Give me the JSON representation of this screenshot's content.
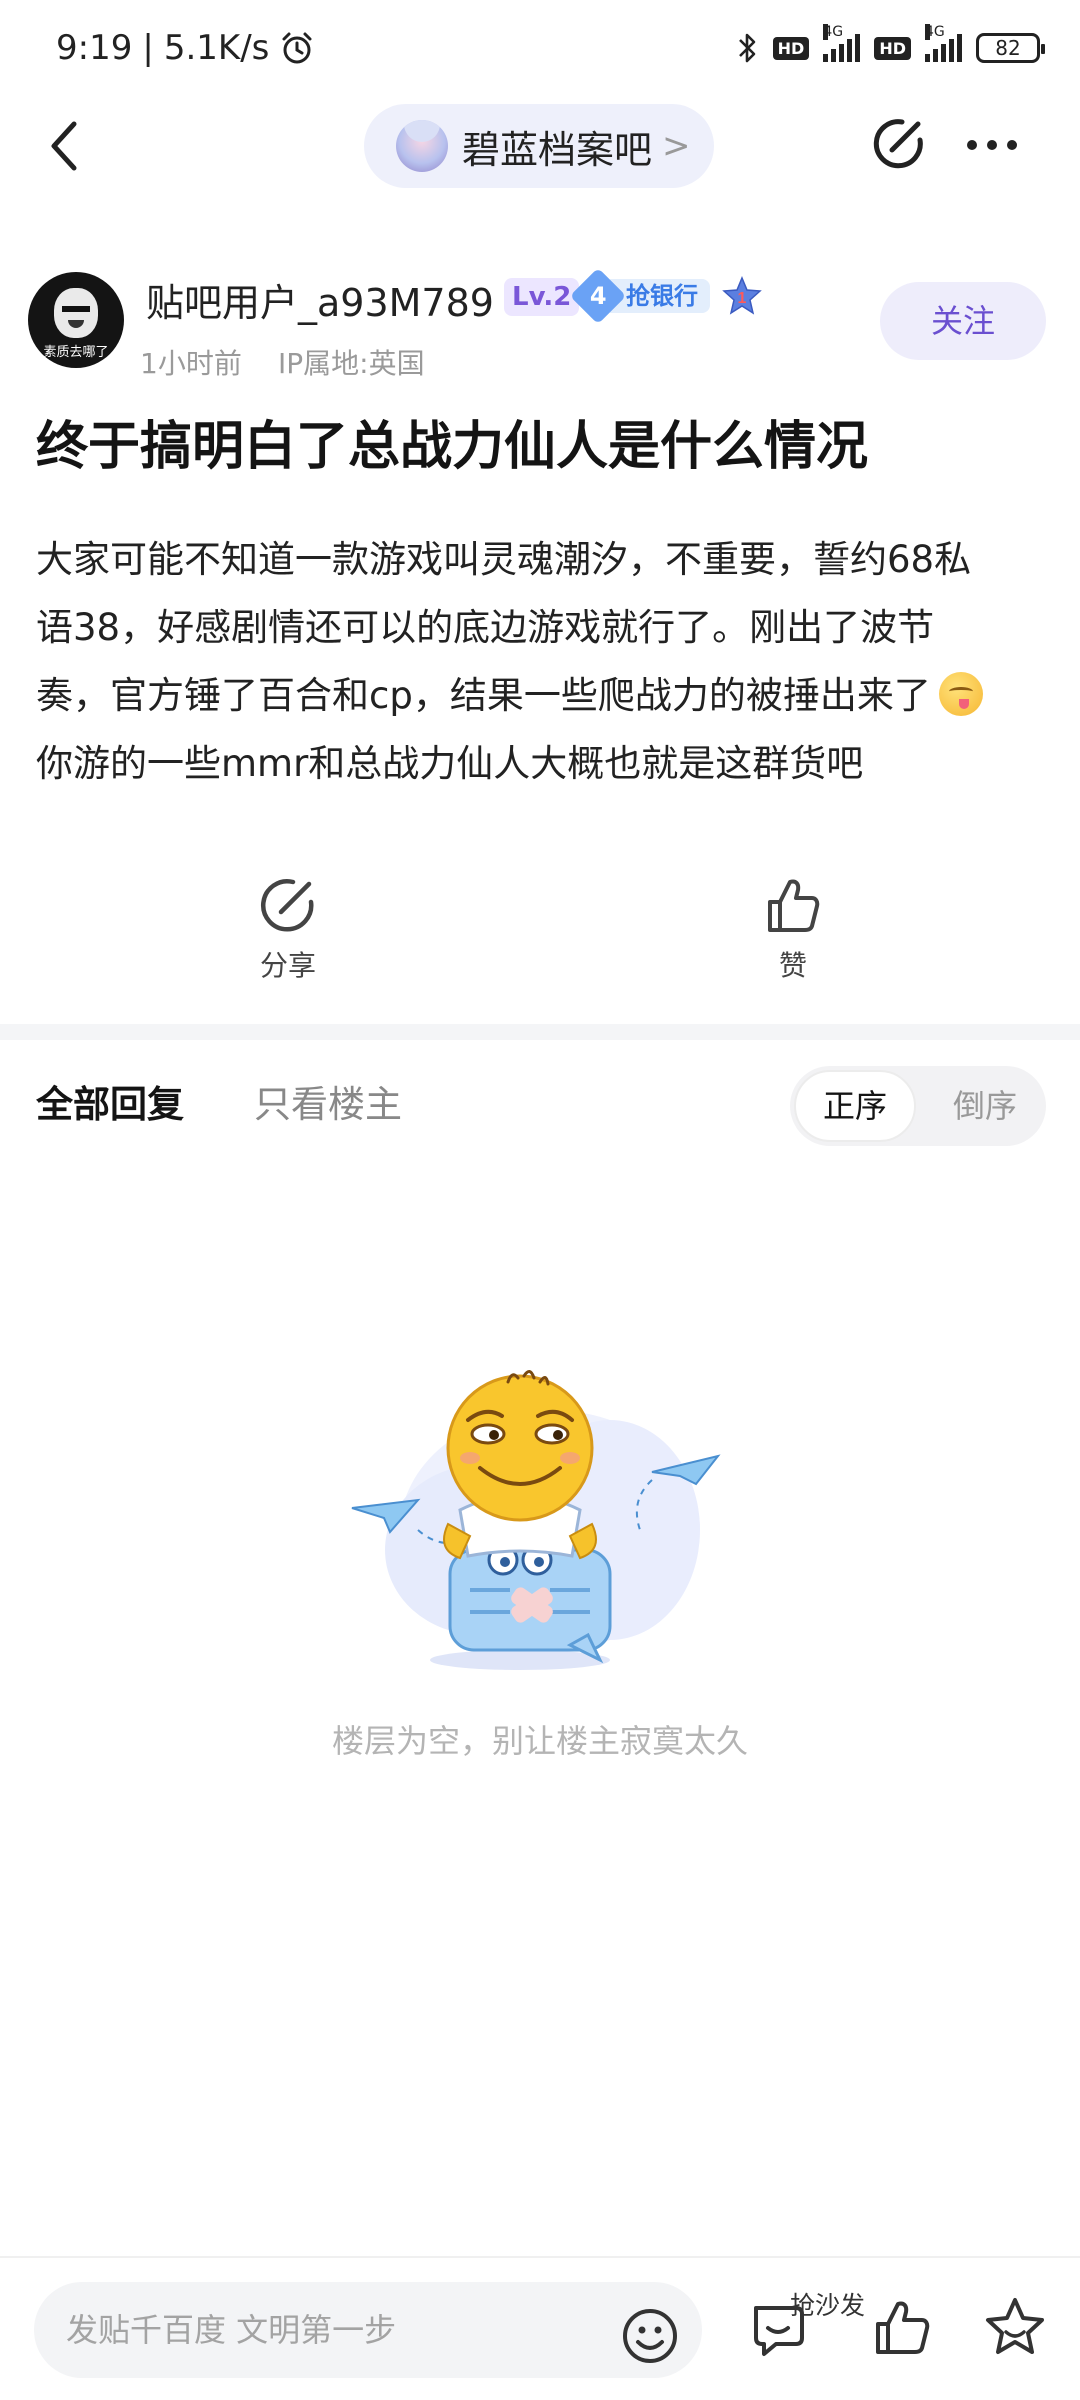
{
  "status_bar": {
    "time": "9:19",
    "separator": "|",
    "net_speed": "5.1K/s",
    "alarm_icon": "alarm-icon",
    "bluetooth_icon": "bluetooth-icon",
    "hd1": "HD",
    "net1": "4G",
    "hd2": "HD",
    "net2": "4G",
    "battery": "82"
  },
  "nav": {
    "back_icon": "chevron-left-icon",
    "forum_name": "碧蓝档案吧",
    "forum_chevron": ">",
    "edit_icon": "edit-icon",
    "more_icon": "more-icon"
  },
  "author": {
    "name": "贴吧用户_a93M789",
    "avatar_caption": "素质去哪了",
    "level": "Lv.2",
    "rank_number": "4",
    "rank_title": "抢银行",
    "star_number": "1",
    "time": "1小时前",
    "ip": "IP属地:英国",
    "follow_label": "关注"
  },
  "post": {
    "title": "终于搞明白了总战力仙人是什么情况",
    "lines": [
      "大家可能不知道一款游戏叫灵魂潮汐，不重要，誓约68私",
      "语38，好感剧情还可以的底边游戏就行了。刚出了波节",
      "奏，官方锤了百合和cp，结果一些爬战力的被捶出来了",
      "你游的一些mmr和总战力仙人大概也就是这群货吧"
    ],
    "inline_emoji": "yum-emoji-icon"
  },
  "actions": {
    "share_label": "分享",
    "like_label": "赞"
  },
  "replies": {
    "tab_all": "全部回复",
    "tab_owner": "只看楼主",
    "order_asc": "正序",
    "order_desc": "倒序",
    "empty_text": "楼层为空，别让楼主寂寞太久"
  },
  "bottom_bar": {
    "input_placeholder": "发贴千百度 文明第一步",
    "sofa_label": "抢沙发"
  },
  "colors": {
    "accent": "#6a4fd0",
    "follow_bg": "#eeedfb",
    "forum_pill_bg": "#eef0fb",
    "muted_text": "#9a9a9a"
  }
}
